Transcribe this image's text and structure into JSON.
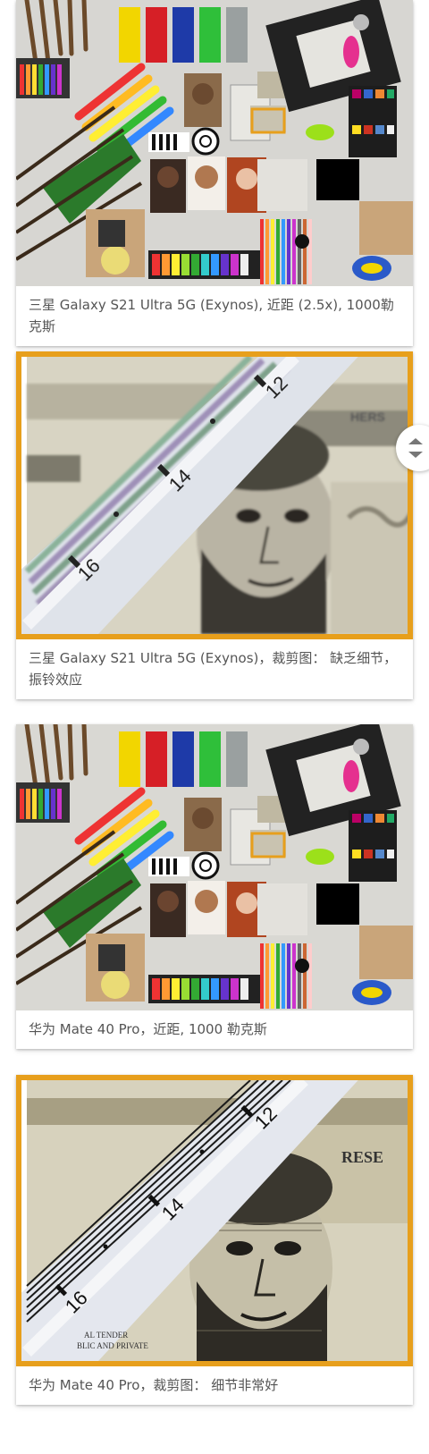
{
  "cards": [
    {
      "caption": "三星 Galaxy S21 Ultra 5G (Exynos), 近距 (2.5x), 1000勒克斯",
      "image": "test-scene-still-life"
    },
    {
      "caption": "三星 Galaxy S21 Ultra 5G (Exynos)，裁剪图： 缺乏细节，振铃效应",
      "image": "crop-banknote-portrait",
      "ruler_marks": [
        "12",
        "14",
        "16"
      ],
      "banknote_text": "HERS"
    },
    {
      "caption": "华为 Mate 40 Pro，近距, 1000 勒克斯",
      "image": "test-scene-still-life"
    },
    {
      "caption": "华为 Mate 40 Pro，裁剪图： 细节非常好",
      "image": "crop-banknote-portrait",
      "ruler_marks": [
        "12",
        "14",
        "16"
      ],
      "banknote_text": "RESE",
      "banknote_small_text": "AL TENDER\nBLIC AND PRIVATE"
    }
  ],
  "colors": {
    "highlight_frame": "#e79f1c",
    "caption_text": "#555555"
  },
  "scroll_button": {
    "icon": "up-down-chevrons-icon"
  }
}
